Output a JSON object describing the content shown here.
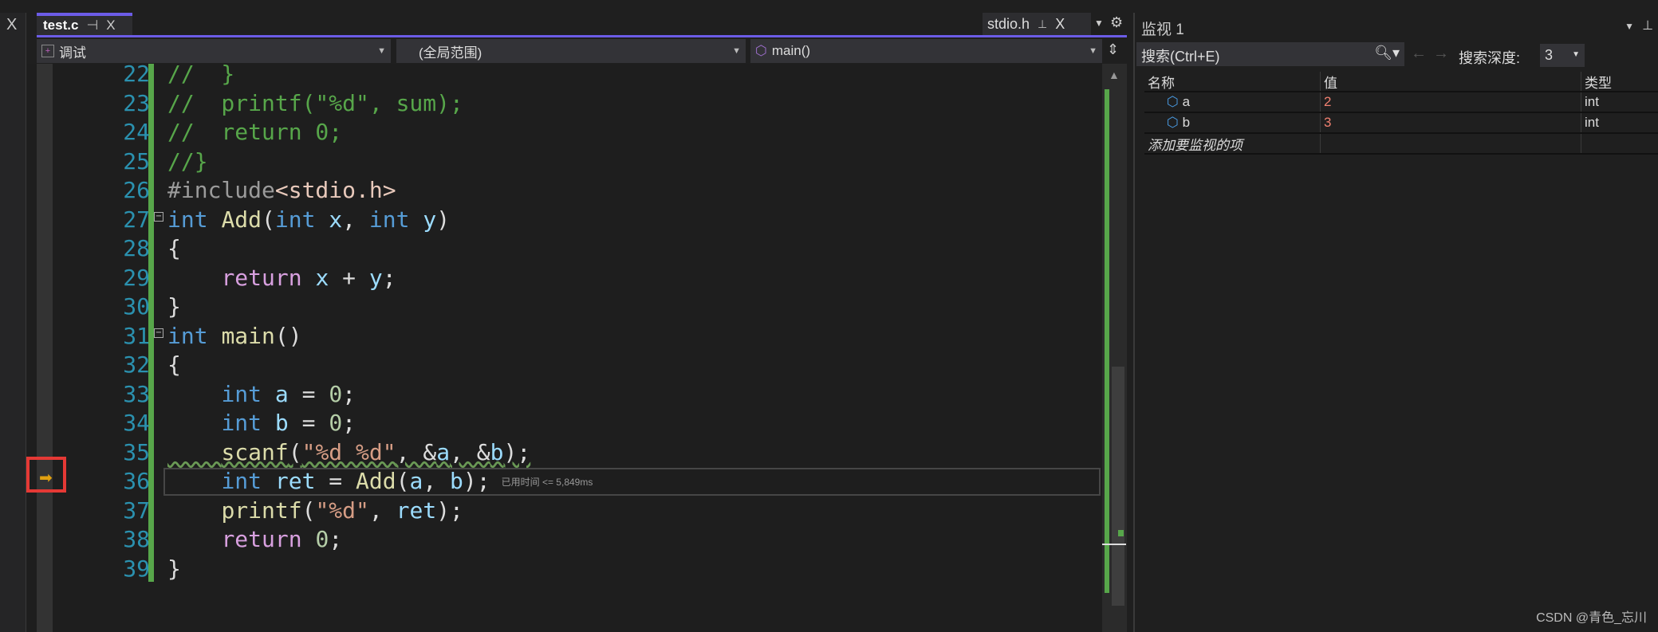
{
  "left_panel": {
    "close": "X"
  },
  "tabs": [
    {
      "label": "test.c",
      "pin": "⊣",
      "close": "X"
    },
    {
      "label": "stdio.h",
      "pin": "⊥",
      "close": "X"
    }
  ],
  "navbar": {
    "project": "调试",
    "scope": "(全局范围)",
    "member": "main()"
  },
  "code_lines": [
    {
      "n": "22",
      "t": [
        [
          "com",
          "//  }"
        ]
      ]
    },
    {
      "n": "23",
      "t": [
        [
          "com",
          "//  printf(\"%d\", sum);"
        ]
      ]
    },
    {
      "n": "24",
      "t": [
        [
          "com",
          "//  return 0;"
        ]
      ]
    },
    {
      "n": "25",
      "t": [
        [
          "com",
          "//}"
        ]
      ]
    },
    {
      "n": "26",
      "t": [
        [
          "pp",
          "#include"
        ],
        [
          "inc",
          "<stdio.h>"
        ]
      ]
    },
    {
      "n": "27",
      "fold": true,
      "t": [
        [
          "kw",
          "int "
        ],
        [
          "fn",
          "Add"
        ],
        [
          "p",
          "("
        ],
        [
          "kw",
          "int "
        ],
        [
          "var",
          "x"
        ],
        [
          "p",
          ", "
        ],
        [
          "kw",
          "int "
        ],
        [
          "var",
          "y"
        ],
        [
          "p",
          ")"
        ]
      ]
    },
    {
      "n": "28",
      "t": [
        [
          "p",
          "{"
        ]
      ]
    },
    {
      "n": "29",
      "t": [
        [
          "p",
          "    "
        ],
        [
          "ret",
          "return "
        ],
        [
          "var",
          "x"
        ],
        [
          "p",
          " + "
        ],
        [
          "var",
          "y"
        ],
        [
          "p",
          ";"
        ]
      ]
    },
    {
      "n": "30",
      "t": [
        [
          "p",
          "}"
        ]
      ]
    },
    {
      "n": "31",
      "fold": true,
      "t": [
        [
          "kw",
          "int "
        ],
        [
          "fn",
          "main"
        ],
        [
          "p",
          "()"
        ]
      ]
    },
    {
      "n": "32",
      "t": [
        [
          "p",
          "{"
        ]
      ]
    },
    {
      "n": "33",
      "t": [
        [
          "p",
          "    "
        ],
        [
          "kw",
          "int "
        ],
        [
          "var",
          "a"
        ],
        [
          "p",
          " = "
        ],
        [
          "num",
          "0"
        ],
        [
          "p",
          ";"
        ]
      ]
    },
    {
      "n": "34",
      "t": [
        [
          "p",
          "    "
        ],
        [
          "kw",
          "int "
        ],
        [
          "var",
          "b"
        ],
        [
          "p",
          " = "
        ],
        [
          "num",
          "0"
        ],
        [
          "p",
          ";"
        ]
      ]
    },
    {
      "n": "35",
      "t": [
        [
          "p",
          "    "
        ],
        [
          "fn",
          "scanf"
        ],
        [
          "p",
          "("
        ],
        [
          "str",
          "\"%d %d\""
        ],
        [
          "p",
          ", &"
        ],
        [
          "var",
          "a"
        ],
        [
          "p",
          ", &"
        ],
        [
          "var",
          "b"
        ],
        [
          "p",
          ");"
        ]
      ],
      "squiggle": true
    },
    {
      "n": "36",
      "t": [
        [
          "p",
          "    "
        ],
        [
          "kw",
          "int "
        ],
        [
          "var",
          "ret"
        ],
        [
          "p",
          " = "
        ],
        [
          "fn",
          "Add"
        ],
        [
          "p",
          "("
        ],
        [
          "var",
          "a"
        ],
        [
          "p",
          ", "
        ],
        [
          "var",
          "b"
        ],
        [
          "p",
          ");"
        ]
      ],
      "hint": "已用时间 <= 5,849ms"
    },
    {
      "n": "37",
      "t": [
        [
          "p",
          "    "
        ],
        [
          "fn",
          "printf"
        ],
        [
          "p",
          "("
        ],
        [
          "str",
          "\"%d\""
        ],
        [
          "p",
          ", "
        ],
        [
          "var",
          "ret"
        ],
        [
          "p",
          ");"
        ]
      ]
    },
    {
      "n": "38",
      "t": [
        [
          "p",
          "    "
        ],
        [
          "ret",
          "return "
        ],
        [
          "num",
          "0"
        ],
        [
          "p",
          ";"
        ]
      ]
    },
    {
      "n": "39",
      "t": [
        [
          "p",
          "}"
        ]
      ]
    }
  ],
  "watch": {
    "title": "监视 1",
    "search_placeholder": "搜索(Ctrl+E)",
    "depth_label": "搜索深度:",
    "depth": "3",
    "headers": {
      "name": "名称",
      "value": "值",
      "type": "类型"
    },
    "rows": [
      {
        "name": "a",
        "value": "2",
        "type": "int"
      },
      {
        "name": "b",
        "value": "3",
        "type": "int"
      }
    ],
    "add_item": "添加要监视的项"
  },
  "watermark": "CSDN @青色_忘川"
}
